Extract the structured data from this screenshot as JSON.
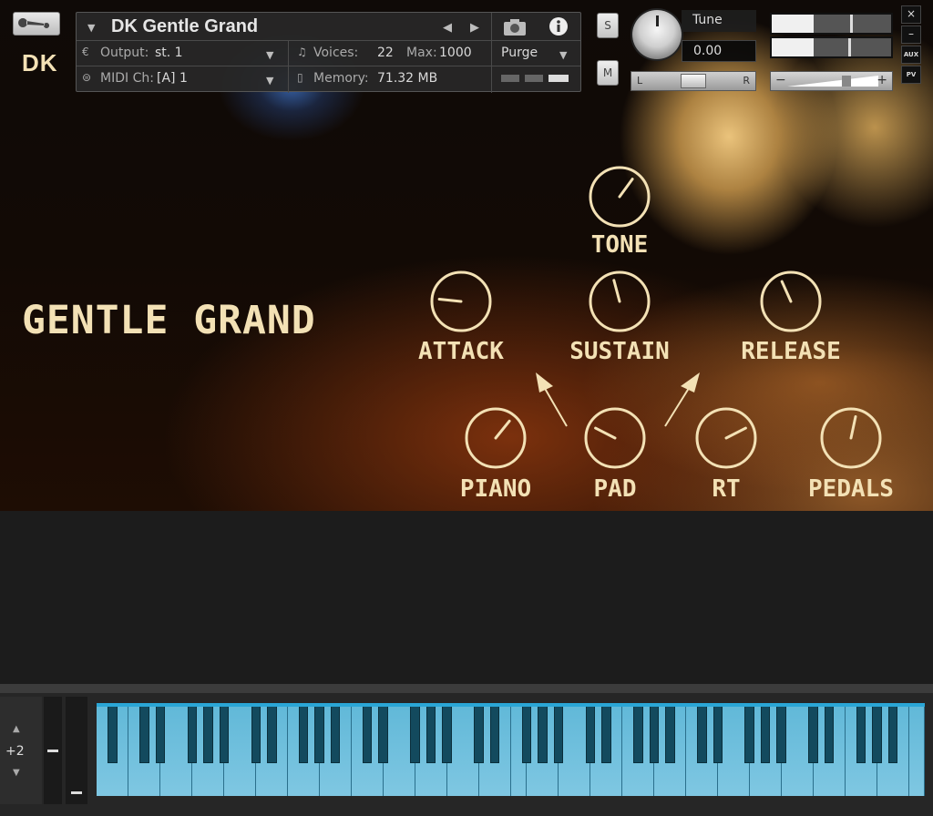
{
  "header": {
    "logo": "DK",
    "instrument_name": "DK Gentle Grand",
    "output_label": "Output:",
    "output_value": "st. 1",
    "voices_label": "Voices:",
    "voices_value": "22",
    "max_label": "Max:",
    "max_value": "1000",
    "purge_label": "Purge",
    "midi_label": "MIDI Ch:",
    "midi_value": "[A]  1",
    "memory_label": "Memory:",
    "memory_value": "71.32 MB",
    "solo_label": "S",
    "mute_label": "M",
    "tune_label": "Tune",
    "tune_value": "0.00",
    "pan_left": "L",
    "pan_right": "R",
    "vol_minus": "−",
    "vol_plus": "+",
    "side_close": "×",
    "side_min": "–",
    "side_aux": "AUX",
    "side_pv": "PV",
    "meter_level": 0.35,
    "volume_level": 0.65
  },
  "panel": {
    "title": "GENTLE  GRAND",
    "colors": {
      "accent": "#f3e1b5"
    },
    "knobs": [
      {
        "id": "tone",
        "label": "TONE",
        "value": 0.62
      },
      {
        "id": "attack",
        "label": "ATTACK",
        "value": 0.22
      },
      {
        "id": "sustain",
        "label": "SUSTAIN",
        "value": 0.45
      },
      {
        "id": "release",
        "label": "RELEASE",
        "value": 0.42
      },
      {
        "id": "piano",
        "label": "PIANO",
        "value": 0.63
      },
      {
        "id": "pad",
        "label": "PAD",
        "value": 0.29
      },
      {
        "id": "rt",
        "label": "RT",
        "value": 0.71
      },
      {
        "id": "pedals",
        "label": "PEDALS",
        "value": 0.54
      }
    ]
  },
  "keyboard": {
    "octave_up": "▲",
    "octave_down": "▼",
    "octave_shift": "+2"
  }
}
